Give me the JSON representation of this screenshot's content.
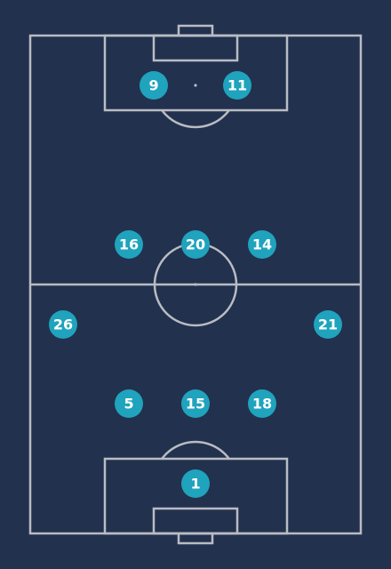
{
  "colors": {
    "background": "#22314e",
    "pitch_lines": "#b9bcc3",
    "player_marker": "#20a3bd",
    "player_number": "#ffffff"
  },
  "players": [
    {
      "number": "9"
    },
    {
      "number": "11"
    },
    {
      "number": "16"
    },
    {
      "number": "20"
    },
    {
      "number": "14"
    },
    {
      "number": "26"
    },
    {
      "number": "21"
    },
    {
      "number": "5"
    },
    {
      "number": "15"
    },
    {
      "number": "18"
    },
    {
      "number": "1"
    }
  ]
}
